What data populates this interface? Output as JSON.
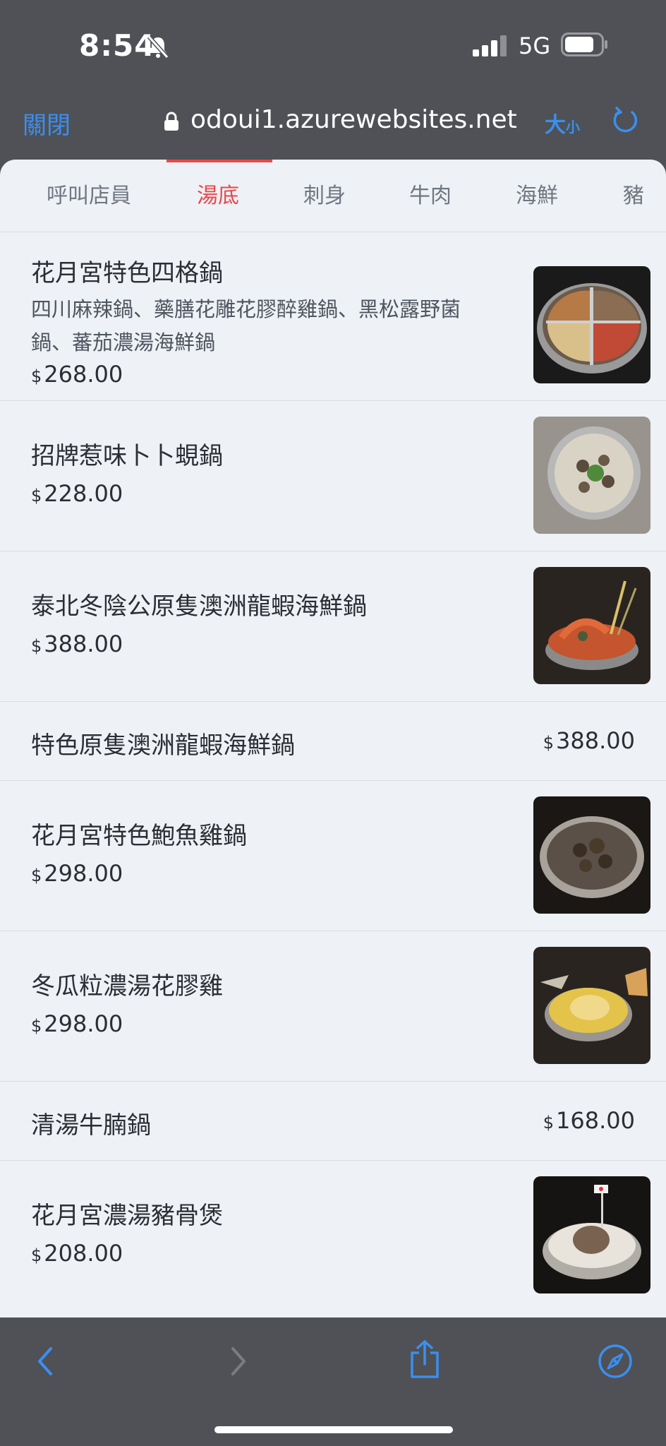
{
  "status_bar": {
    "time": "8:54",
    "network": "5G"
  },
  "browser": {
    "close_label": "關閉",
    "url": "odoui1.azurewebsites.net",
    "text_size_big": "大",
    "text_size_small": "小"
  },
  "tabs": [
    {
      "label": "呼叫店員",
      "active": false
    },
    {
      "label": "湯底",
      "active": true
    },
    {
      "label": "刺身",
      "active": false
    },
    {
      "label": "牛肉",
      "active": false
    },
    {
      "label": "海鮮",
      "active": false
    },
    {
      "label": "豬",
      "active": false
    }
  ],
  "currency_symbol": "$",
  "menu": [
    {
      "name": "花月宮特色四格鍋",
      "desc": "四川麻辣鍋、藥膳花雕花膠醉雞鍋、黑松露野菌鍋、蕃茄濃湯海鮮鍋",
      "price": "268.00"
    },
    {
      "name": "招牌惹味卜卜蜆鍋",
      "price": "228.00"
    },
    {
      "name": "泰北冬陰公原隻澳洲龍蝦海鮮鍋",
      "price": "388.00"
    },
    {
      "name": "特色原隻澳洲龍蝦海鮮鍋",
      "price": "388.00"
    },
    {
      "name": "花月宮特色鮑魚雞鍋",
      "price": "298.00"
    },
    {
      "name": "冬瓜粒濃湯花膠雞",
      "price": "298.00"
    },
    {
      "name": "清湯牛腩鍋",
      "price": "168.00"
    },
    {
      "name": "花月宮濃湯豬骨煲",
      "price": "208.00"
    }
  ]
}
